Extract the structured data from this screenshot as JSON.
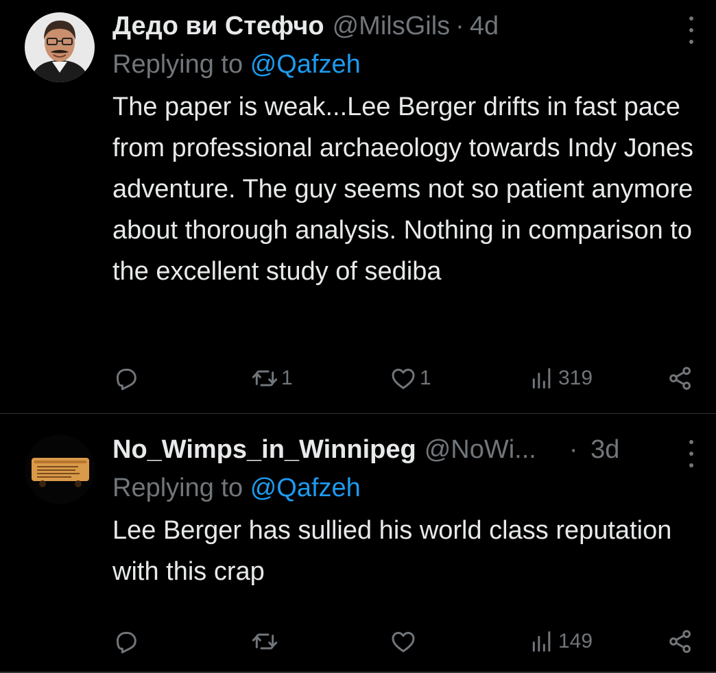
{
  "tweets": [
    {
      "display_name": "Дедо ви Стефчо",
      "handle": "@MilsGils",
      "separator": "·",
      "time": "4d",
      "replying_prefix": "Replying to",
      "replying_to": "@Qafzeh",
      "text": "The paper is weak...Lee Berger drifts in fast pace from professional archaeology towards Indy Jones adventure. The guy seems not so patient anymore about thorough analysis. Nothing in comparison to the excellent study of sediba",
      "retweets": "1",
      "likes": "1",
      "views": "319",
      "icons": {
        "reply": "reply-icon",
        "retweet": "retweet-icon",
        "like": "heart-icon",
        "views": "views-icon",
        "share": "share-icon",
        "more": "more-icon"
      }
    },
    {
      "display_name": "No_Wimps_in_Winnipeg",
      "handle": "@NoWi",
      "handle_ellipsis": "...",
      "separator": "·",
      "time": "3d",
      "replying_prefix": "Replying to",
      "replying_to": "@Qafzeh",
      "text": "Lee Berger has sullied his world class reputation with this crap",
      "retweets": "",
      "likes": "",
      "views": "149",
      "icons": {
        "reply": "reply-icon",
        "retweet": "retweet-icon",
        "like": "heart-icon",
        "views": "views-icon",
        "share": "share-icon",
        "more": "more-icon"
      }
    }
  ],
  "colors": {
    "background": "#000000",
    "text": "#e7e9ea",
    "secondary": "#71767b",
    "link": "#1d9bf0",
    "divider": "#2f3336"
  }
}
